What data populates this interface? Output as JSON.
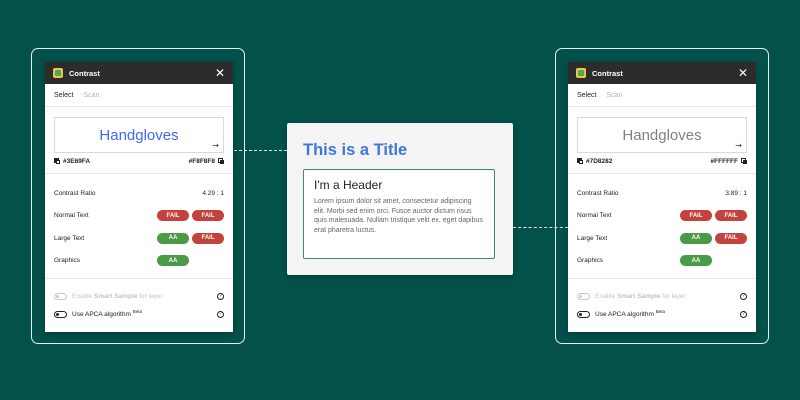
{
  "colors": {
    "background": "#03514A",
    "fail": "#C4423D",
    "pass": "#4A9A47",
    "card_title": "#3D78D8"
  },
  "panels": [
    {
      "window_title": "Contrast",
      "tabs": [
        "Select",
        "Scan"
      ],
      "preview_text": "Handgloves",
      "preview_color": "#3E69FA",
      "foreground": "#3E69FA",
      "background": "#F8F8F8",
      "ratio_label": "Contrast Ratio",
      "ratio_value": "4.29 : 1",
      "rows": [
        {
          "label": "Normal Text",
          "badges": [
            "FAIL",
            "FAIL"
          ]
        },
        {
          "label": "Large Text",
          "badges": [
            "AA",
            "FAIL"
          ]
        },
        {
          "label": "Graphics",
          "badges": [
            "AA"
          ]
        }
      ],
      "options": {
        "smart_sample_prefix": "Enable ",
        "smart_sample_bold": "Smart Sample",
        "smart_sample_suffix": " for layer",
        "apca": "Use APCA algorithm",
        "apca_sup": "Beta",
        "help": "?"
      }
    },
    {
      "window_title": "Contrast",
      "tabs": [
        "Select",
        "Scan"
      ],
      "preview_text": "Handgloves",
      "preview_color": "#7D8282",
      "foreground": "#7D8282",
      "background": "#FFFFFF",
      "ratio_label": "Contrast Ratio",
      "ratio_value": "3.89 : 1",
      "rows": [
        {
          "label": "Normal Text",
          "badges": [
            "FAIL",
            "FAIL"
          ]
        },
        {
          "label": "Large Text",
          "badges": [
            "AA",
            "FAIL"
          ]
        },
        {
          "label": "Graphics",
          "badges": [
            "AA"
          ]
        }
      ],
      "options": {
        "smart_sample_prefix": "Enable ",
        "smart_sample_bold": "Smart Sample",
        "smart_sample_suffix": " for layer",
        "apca": "Use APCA algorithm",
        "apca_sup": "Beta",
        "help": "?"
      }
    }
  ],
  "card": {
    "title": "This is a Title",
    "header": "I'm a Header",
    "body": "Lorem ipsum dolor sit amet, consectetur adipiscing elit. Morbi sed enim orci. Fusce auctor dictum risus quis malesuada. Nullam tristique velit ex, eget dapibus erat pharetra luctus."
  }
}
